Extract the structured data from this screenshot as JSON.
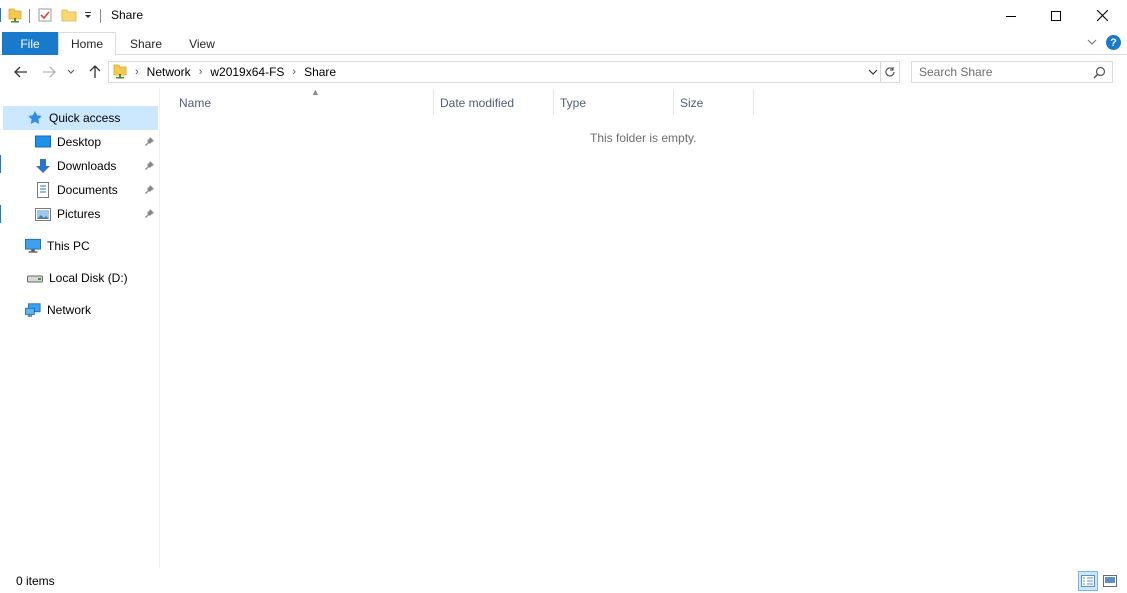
{
  "window": {
    "title": "Share"
  },
  "ribbon": {
    "tabs": {
      "file": "File",
      "home": "Home",
      "share": "Share",
      "view": "View"
    },
    "help_label": "?"
  },
  "address": {
    "breadcrumbs": [
      "Network",
      "w2019x64-FS",
      "Share"
    ]
  },
  "search": {
    "placeholder": "Search Share"
  },
  "navigation": {
    "quick_access": "Quick access",
    "pinned": [
      "Desktop",
      "Downloads",
      "Documents",
      "Pictures"
    ],
    "this_pc": "This PC",
    "local_disk": "Local Disk (D:)",
    "network": "Network"
  },
  "columns": {
    "name": "Name",
    "date_modified": "Date modified",
    "type": "Type",
    "size": "Size"
  },
  "content": {
    "empty_message": "This folder is empty."
  },
  "status": {
    "items_count": "0 items"
  },
  "colors": {
    "accent": "#1979ca",
    "selection": "#cce8ff",
    "column_header_text": "#4c607a"
  },
  "icons": {
    "folder": "folder-icon",
    "network_folder": "network-share-icon",
    "quick_access": "star-icon",
    "desktop": "desktop-icon",
    "downloads": "download-arrow-icon",
    "documents": "document-icon",
    "pictures": "pictures-icon",
    "this_pc": "monitor-icon",
    "local_disk": "drive-icon",
    "network": "network-icon",
    "pin": "pin-icon"
  }
}
